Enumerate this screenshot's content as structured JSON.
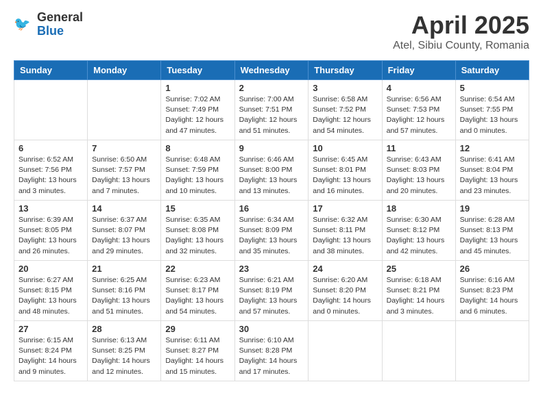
{
  "header": {
    "logo": {
      "general": "General",
      "blue": "Blue"
    },
    "title": "April 2025",
    "location": "Atel, Sibiu County, Romania"
  },
  "weekdays": [
    "Sunday",
    "Monday",
    "Tuesday",
    "Wednesday",
    "Thursday",
    "Friday",
    "Saturday"
  ],
  "weeks": [
    [
      {
        "day": "",
        "empty": true
      },
      {
        "day": "",
        "empty": true
      },
      {
        "day": "1",
        "sunrise": "Sunrise: 7:02 AM",
        "sunset": "Sunset: 7:49 PM",
        "daylight": "Daylight: 12 hours and 47 minutes."
      },
      {
        "day": "2",
        "sunrise": "Sunrise: 7:00 AM",
        "sunset": "Sunset: 7:51 PM",
        "daylight": "Daylight: 12 hours and 51 minutes."
      },
      {
        "day": "3",
        "sunrise": "Sunrise: 6:58 AM",
        "sunset": "Sunset: 7:52 PM",
        "daylight": "Daylight: 12 hours and 54 minutes."
      },
      {
        "day": "4",
        "sunrise": "Sunrise: 6:56 AM",
        "sunset": "Sunset: 7:53 PM",
        "daylight": "Daylight: 12 hours and 57 minutes."
      },
      {
        "day": "5",
        "sunrise": "Sunrise: 6:54 AM",
        "sunset": "Sunset: 7:55 PM",
        "daylight": "Daylight: 13 hours and 0 minutes."
      }
    ],
    [
      {
        "day": "6",
        "sunrise": "Sunrise: 6:52 AM",
        "sunset": "Sunset: 7:56 PM",
        "daylight": "Daylight: 13 hours and 3 minutes."
      },
      {
        "day": "7",
        "sunrise": "Sunrise: 6:50 AM",
        "sunset": "Sunset: 7:57 PM",
        "daylight": "Daylight: 13 hours and 7 minutes."
      },
      {
        "day": "8",
        "sunrise": "Sunrise: 6:48 AM",
        "sunset": "Sunset: 7:59 PM",
        "daylight": "Daylight: 13 hours and 10 minutes."
      },
      {
        "day": "9",
        "sunrise": "Sunrise: 6:46 AM",
        "sunset": "Sunset: 8:00 PM",
        "daylight": "Daylight: 13 hours and 13 minutes."
      },
      {
        "day": "10",
        "sunrise": "Sunrise: 6:45 AM",
        "sunset": "Sunset: 8:01 PM",
        "daylight": "Daylight: 13 hours and 16 minutes."
      },
      {
        "day": "11",
        "sunrise": "Sunrise: 6:43 AM",
        "sunset": "Sunset: 8:03 PM",
        "daylight": "Daylight: 13 hours and 20 minutes."
      },
      {
        "day": "12",
        "sunrise": "Sunrise: 6:41 AM",
        "sunset": "Sunset: 8:04 PM",
        "daylight": "Daylight: 13 hours and 23 minutes."
      }
    ],
    [
      {
        "day": "13",
        "sunrise": "Sunrise: 6:39 AM",
        "sunset": "Sunset: 8:05 PM",
        "daylight": "Daylight: 13 hours and 26 minutes."
      },
      {
        "day": "14",
        "sunrise": "Sunrise: 6:37 AM",
        "sunset": "Sunset: 8:07 PM",
        "daylight": "Daylight: 13 hours and 29 minutes."
      },
      {
        "day": "15",
        "sunrise": "Sunrise: 6:35 AM",
        "sunset": "Sunset: 8:08 PM",
        "daylight": "Daylight: 13 hours and 32 minutes."
      },
      {
        "day": "16",
        "sunrise": "Sunrise: 6:34 AM",
        "sunset": "Sunset: 8:09 PM",
        "daylight": "Daylight: 13 hours and 35 minutes."
      },
      {
        "day": "17",
        "sunrise": "Sunrise: 6:32 AM",
        "sunset": "Sunset: 8:11 PM",
        "daylight": "Daylight: 13 hours and 38 minutes."
      },
      {
        "day": "18",
        "sunrise": "Sunrise: 6:30 AM",
        "sunset": "Sunset: 8:12 PM",
        "daylight": "Daylight: 13 hours and 42 minutes."
      },
      {
        "day": "19",
        "sunrise": "Sunrise: 6:28 AM",
        "sunset": "Sunset: 8:13 PM",
        "daylight": "Daylight: 13 hours and 45 minutes."
      }
    ],
    [
      {
        "day": "20",
        "sunrise": "Sunrise: 6:27 AM",
        "sunset": "Sunset: 8:15 PM",
        "daylight": "Daylight: 13 hours and 48 minutes."
      },
      {
        "day": "21",
        "sunrise": "Sunrise: 6:25 AM",
        "sunset": "Sunset: 8:16 PM",
        "daylight": "Daylight: 13 hours and 51 minutes."
      },
      {
        "day": "22",
        "sunrise": "Sunrise: 6:23 AM",
        "sunset": "Sunset: 8:17 PM",
        "daylight": "Daylight: 13 hours and 54 minutes."
      },
      {
        "day": "23",
        "sunrise": "Sunrise: 6:21 AM",
        "sunset": "Sunset: 8:19 PM",
        "daylight": "Daylight: 13 hours and 57 minutes."
      },
      {
        "day": "24",
        "sunrise": "Sunrise: 6:20 AM",
        "sunset": "Sunset: 8:20 PM",
        "daylight": "Daylight: 14 hours and 0 minutes."
      },
      {
        "day": "25",
        "sunrise": "Sunrise: 6:18 AM",
        "sunset": "Sunset: 8:21 PM",
        "daylight": "Daylight: 14 hours and 3 minutes."
      },
      {
        "day": "26",
        "sunrise": "Sunrise: 6:16 AM",
        "sunset": "Sunset: 8:23 PM",
        "daylight": "Daylight: 14 hours and 6 minutes."
      }
    ],
    [
      {
        "day": "27",
        "sunrise": "Sunrise: 6:15 AM",
        "sunset": "Sunset: 8:24 PM",
        "daylight": "Daylight: 14 hours and 9 minutes."
      },
      {
        "day": "28",
        "sunrise": "Sunrise: 6:13 AM",
        "sunset": "Sunset: 8:25 PM",
        "daylight": "Daylight: 14 hours and 12 minutes."
      },
      {
        "day": "29",
        "sunrise": "Sunrise: 6:11 AM",
        "sunset": "Sunset: 8:27 PM",
        "daylight": "Daylight: 14 hours and 15 minutes."
      },
      {
        "day": "30",
        "sunrise": "Sunrise: 6:10 AM",
        "sunset": "Sunset: 8:28 PM",
        "daylight": "Daylight: 14 hours and 17 minutes."
      },
      {
        "day": "",
        "empty": true
      },
      {
        "day": "",
        "empty": true
      },
      {
        "day": "",
        "empty": true
      }
    ]
  ]
}
